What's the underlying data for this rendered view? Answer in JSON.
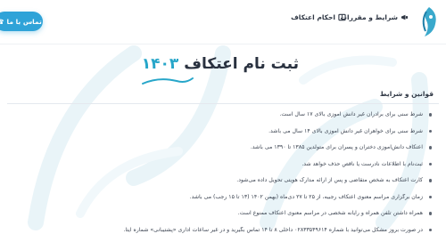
{
  "header": {
    "nav": [
      {
        "label": "شرایط و مقررات",
        "icon": "megaphone-icon"
      },
      {
        "label": "احکام اعتکاف",
        "icon": "book-icon"
      }
    ],
    "contact_button": "تماس با ما"
  },
  "hero": {
    "title": "ثبت نام اعتکاف",
    "year": "۱۴۰۳"
  },
  "terms": {
    "title": "قوانین و شرایط",
    "items": [
      "شرط سنی برای برادران غیر دانش آموزی بالای ۱۷ سال است.",
      "شرط سنی برای خواهران غیر دانش آموزی بالای ۱۴ سال می باشد.",
      "اعتکاف دانش‌آموزی دختران و پسران برای متولدین ۱۳۸۵ تا ۱۳۹۰ می باشد.",
      "ثبت‌نام با اطلاعات نادرست یا ناقص حذف خواهد شد.",
      "کارت اعتکاف به شخص متقاضی و پس از ارائه مدارک هویتی تحویل داده می‌شود.",
      "زمان برگزاری مراسم معنوی اعتکاف رجبیه، از ۲۵ تا ۲۷ دی‌ماه (بهمن ۱۴۰۲ (۱۳ تا ۱۵ رجب) می باشد.",
      "همراه داشتن تلفن همراه و رایانه شخصی در مراسم معنوی اعتکاف ممنوع است.",
      "در صورت بروز مشکل می‌توانید با شماره ۰۲۸۳۳۵۴۹۶۱۴ داخلی ۸ تا ۱۴ تماس بگیرید و در غیر ساعات اداری «پشتیبانی» شماره ایتا."
    ]
  },
  "colors": {
    "accent": "#2fa3d8",
    "year": "#27a6c9",
    "text": "#333a44"
  }
}
